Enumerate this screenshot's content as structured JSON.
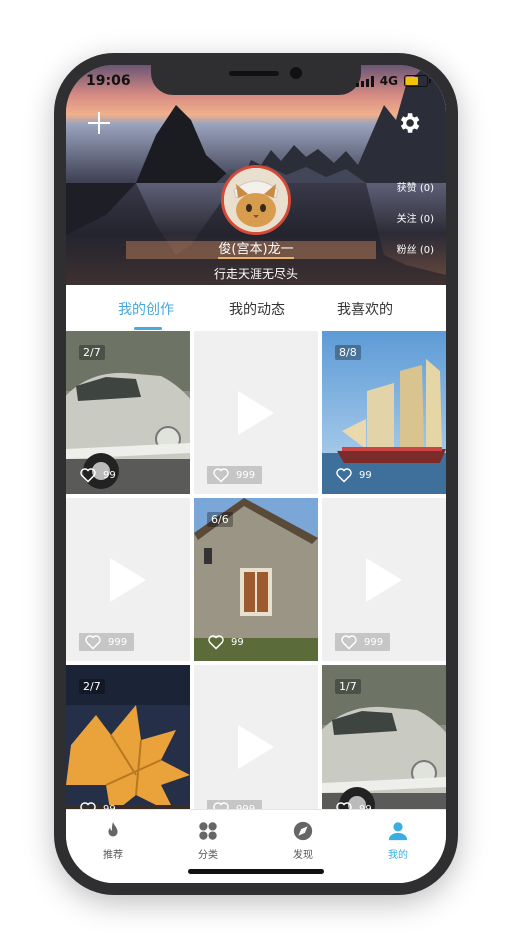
{
  "status_bar": {
    "time": "19:06",
    "network": "4G"
  },
  "profile": {
    "username": "俊(宫本)龙一",
    "motto": "行走天涯无尽头",
    "stats": [
      "获赞 (0)",
      "关注 (0)",
      "粉丝 (0)"
    ]
  },
  "tabs": [
    "我的创作",
    "我的动态",
    "我喜欢的"
  ],
  "active_tab": 0,
  "grid": [
    {
      "type": "photo",
      "count": "2/7",
      "likes": "99",
      "thumb": "vintage-car"
    },
    {
      "type": "video",
      "likes": "999"
    },
    {
      "type": "photo",
      "count": "8/8",
      "likes": "99",
      "thumb": "sailing-ship"
    },
    {
      "type": "video",
      "likes": "999"
    },
    {
      "type": "photo",
      "count": "6/6",
      "likes": "99",
      "thumb": "old-house"
    },
    {
      "type": "video",
      "likes": "999"
    },
    {
      "type": "photo",
      "count": "2/7",
      "likes": "99",
      "thumb": "autumn-leaf"
    },
    {
      "type": "video",
      "likes": "999"
    },
    {
      "type": "photo",
      "count": "1/7",
      "likes": "99",
      "thumb": "vintage-car"
    }
  ],
  "tabbar": [
    {
      "label": "推荐",
      "icon": "flame-icon"
    },
    {
      "label": "分类",
      "icon": "grid-icon"
    },
    {
      "label": "发现",
      "icon": "compass-icon"
    },
    {
      "label": "我的",
      "icon": "user-icon"
    }
  ],
  "active_tabbar": 3,
  "colors": {
    "accent": "#48a9de",
    "tabbar_active": "#3aaee0",
    "avatar_border": "#d44a36"
  }
}
